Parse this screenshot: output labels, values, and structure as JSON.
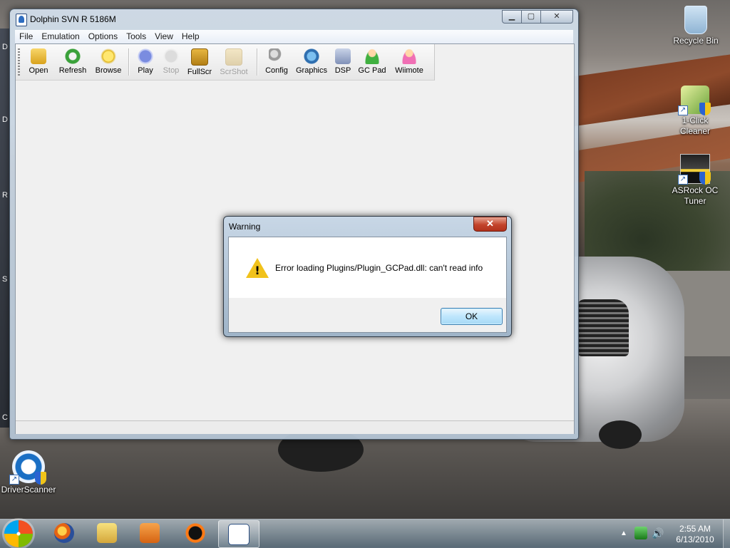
{
  "desktop": {
    "icons": [
      {
        "label": "Recycle Bin"
      },
      {
        "label": "1-Click Cleaner"
      },
      {
        "label": "ASRock OC Tuner"
      },
      {
        "label": "DriverScanner"
      }
    ],
    "left_edge_letters": [
      "D",
      "D",
      "R",
      "S",
      "C"
    ]
  },
  "window": {
    "title": "Dolphin SVN R 5186M",
    "caption_buttons": {
      "minimize": "▁",
      "maximize": "▢",
      "close": "✕"
    },
    "menu": [
      "File",
      "Emulation",
      "Options",
      "Tools",
      "View",
      "Help"
    ],
    "toolbar": [
      {
        "label": "Open",
        "icon": "folder-open-icon",
        "enabled": true
      },
      {
        "label": "Refresh",
        "icon": "refresh-icon",
        "enabled": true
      },
      {
        "label": "Browse",
        "icon": "star-icon",
        "enabled": true
      },
      {
        "label": "Play",
        "icon": "play-icon",
        "enabled": true
      },
      {
        "label": "Stop",
        "icon": "stop-icon",
        "enabled": false
      },
      {
        "label": "FullScr",
        "icon": "fullscreen-icon",
        "enabled": true
      },
      {
        "label": "ScrShot",
        "icon": "screenshot-icon",
        "enabled": false
      },
      {
        "label": "Config",
        "icon": "wrench-icon",
        "enabled": true
      },
      {
        "label": "Graphics",
        "icon": "graphics-icon",
        "enabled": true
      },
      {
        "label": "DSP",
        "icon": "speaker-icon",
        "enabled": true
      },
      {
        "label": "GC Pad",
        "icon": "gc-pad-icon",
        "enabled": true
      },
      {
        "label": "Wiimote",
        "icon": "wiimote-icon",
        "enabled": true
      }
    ]
  },
  "dialog": {
    "title": "Warning",
    "close_glyph": "✕",
    "warning_mark": "!",
    "message": "Error loading Plugins/Plugin_GCPad.dll: can't read info",
    "ok_label": "OK"
  },
  "taskbar": {
    "clock_time": "2:55 AM",
    "clock_date": "6/13/2010",
    "tray_arrow": "▲",
    "volume_glyph": "🔊"
  }
}
